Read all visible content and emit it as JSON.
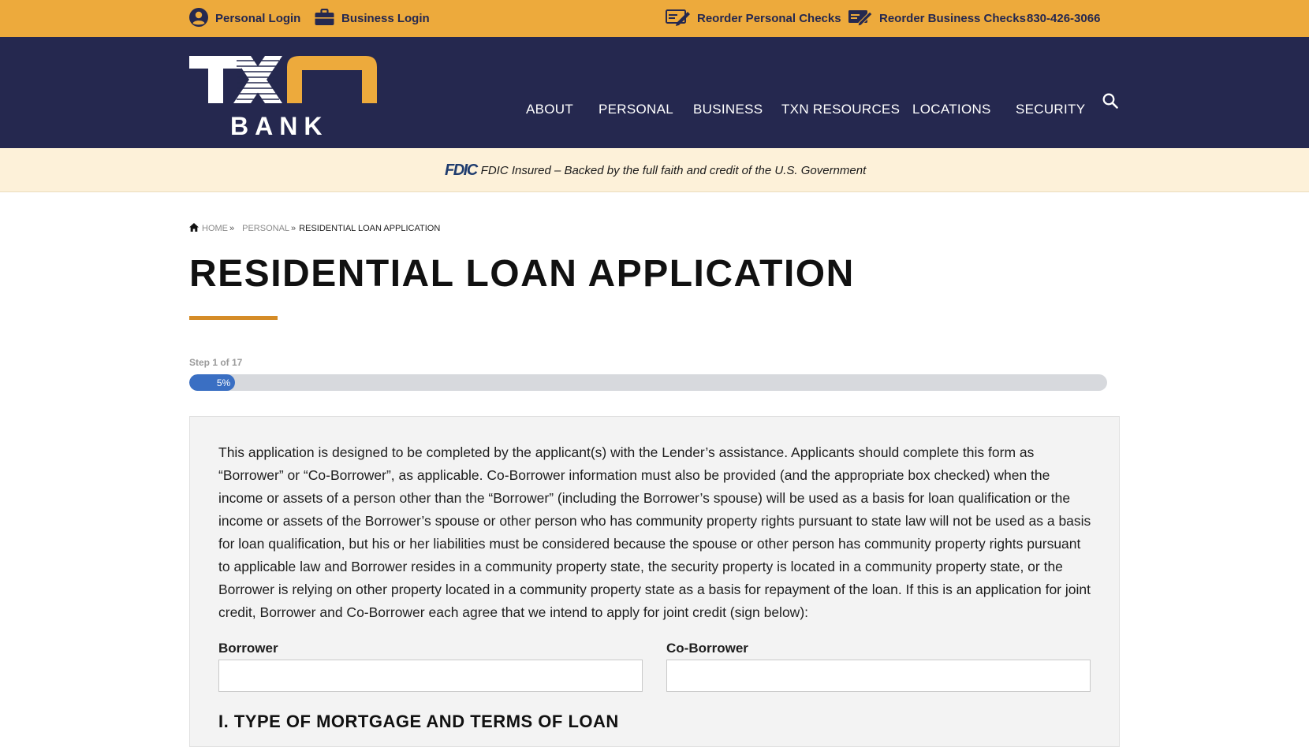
{
  "utility_bar": {
    "personal_login": "Personal Login",
    "business_login": "Business Login",
    "reorder_personal": "Reorder Personal Checks",
    "reorder_business": "Reorder Business Checks",
    "phone": "830-426-3066",
    "icons": [
      "user-circle-icon",
      "briefcase-icon",
      "check-pen-icon",
      "check-pen-icon"
    ]
  },
  "logo": {
    "letters": "TXN",
    "word": "BANK"
  },
  "nav": {
    "items": [
      "ABOUT",
      "PERSONAL",
      "BUSINESS",
      "TXN RESOURCES",
      "LOCATIONS",
      "SECURITY"
    ],
    "search_icon": "search-icon"
  },
  "fdic": {
    "logo": "FDIC",
    "text": "FDIC Insured – Backed by the full faith and credit of the U.S. Government"
  },
  "breadcrumb": {
    "home": "HOME",
    "personal": "PERSONAL",
    "current": "RESIDENTIAL LOAN APPLICATION",
    "separator": "»"
  },
  "page": {
    "title": "RESIDENTIAL LOAN APPLICATION"
  },
  "progress": {
    "step_label": "Step 1 of 17",
    "percent_text": "5%",
    "fraction": 0.05
  },
  "form": {
    "intro": "This application is designed to be completed by the applicant(s) with the Lender’s assistance. Applicants should complete this form as “Borrower” or “Co-Borrower”, as applicable. Co-Borrower information must also be provided (and the appropriate box checked) when the income or assets of a person other than the “Borrower” (including the Borrower’s spouse) will be used as a basis for loan qualification or the income or assets of the Borrower’s spouse or other person who has community property rights pursuant to state law will not be used as a basis for loan qualification, but his or her liabilities must be considered because the spouse or other person has community property rights pursuant to applicable law and Borrower resides in a community property state, the security property is located in a community property state, or the Borrower is relying on other property located in a community property state as a basis for repayment of the loan. If this is an application for joint credit, Borrower and Co-Borrower each agree that we intend to apply for joint credit (sign below):",
    "borrower_label": "Borrower",
    "borrower_value": "",
    "coborrower_label": "Co-Borrower",
    "coborrower_value": "",
    "section_heading": "I. TYPE OF MORTGAGE AND TERMS OF LOAN"
  },
  "colors": {
    "utility_bar": "#edaa3c",
    "navy": "#25284f",
    "fdic_band": "#fdf1d9",
    "accent_rule": "#d58c27",
    "progress_fill": "#3a6fc3"
  }
}
